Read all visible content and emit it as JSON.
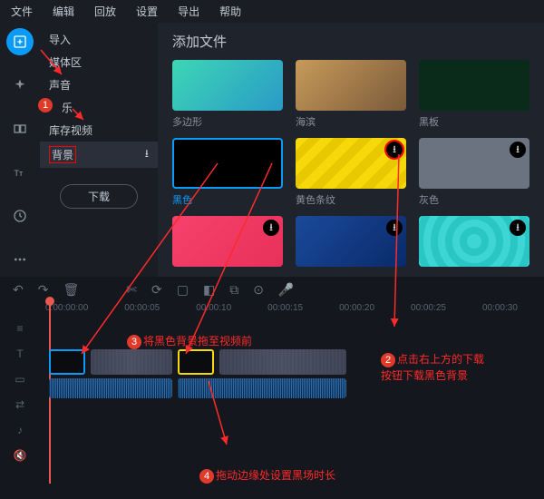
{
  "menu": [
    "文件",
    "编辑",
    "回放",
    "设置",
    "导出",
    "帮助"
  ],
  "sidebar": {
    "items": [
      "导入",
      "媒体区",
      "声音",
      "乐",
      "库存视频",
      "背景"
    ],
    "download_btn": "下载",
    "active_index": 5
  },
  "content": {
    "title": "添加文件",
    "tiles": [
      {
        "label": "多边形",
        "bg": "linear-gradient(135deg,#3dd6b5,#2a9ac7)"
      },
      {
        "label": "海滨",
        "bg": "linear-gradient(135deg,#c79a5a,#7a5a3a)"
      },
      {
        "label": "黑板",
        "bg": "#0a2a1a"
      },
      {
        "label": "黑色",
        "bg": "#000",
        "selected": true
      },
      {
        "label": "黄色条纹",
        "bg": "repeating-linear-gradient(135deg,#f5d90a 0 10px,#e8c800 10px 20px)",
        "dl": true,
        "highlight": true
      },
      {
        "label": "灰色",
        "bg": "#6b7280",
        "dl": true
      },
      {
        "label": "",
        "bg": "linear-gradient(135deg,#f5426c,#e8305a)",
        "dl": true
      },
      {
        "label": "",
        "bg": "linear-gradient(135deg,#1a4a9a,#0a2a6a)",
        "dl": true
      },
      {
        "label": "",
        "bg": "repeating-radial-gradient(circle,#3dd6d5 0 8px,#2ac6c5 8px 16px)",
        "dl": true
      }
    ]
  },
  "ruler": [
    "0:00:00:00",
    "00:00:05",
    "00:00:10",
    "00:00:15",
    "00:00:20",
    "00:00:25",
    "00:00:30"
  ],
  "annotations": {
    "a1": "将黑色背景拖至视频前",
    "a2_l1": "点击右上方的下载",
    "a2_l2": "按钮下载黑色背景",
    "a3": "拖动边缘处设置黑场时长"
  },
  "badges": {
    "b1": "1",
    "b2": "2",
    "b3": "3",
    "b4": "4"
  },
  "dl_glyph": "⭳"
}
